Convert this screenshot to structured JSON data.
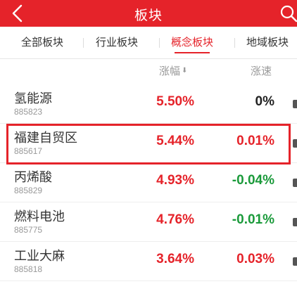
{
  "header": {
    "title": "板块",
    "back_icon": "chevron-left-icon",
    "search_icon": "search-icon",
    "background": "#e5232a"
  },
  "tabs": [
    {
      "label": "全部板块",
      "active": false
    },
    {
      "label": "行业板块",
      "active": false
    },
    {
      "label": "概念板块",
      "active": true
    },
    {
      "label": "地域板块",
      "active": false
    }
  ],
  "columns": {
    "change": "涨幅",
    "change_sort_icon": "arrow-down-icon",
    "speed": "涨速"
  },
  "rows": [
    {
      "name": "氢能源",
      "code": "885823",
      "change": "5.50%",
      "speed": "0%",
      "speed_color": "#222222",
      "highlighted": false
    },
    {
      "name": "福建自贸区",
      "code": "885617",
      "change": "5.44%",
      "speed": "0.01%",
      "speed_color": "#e5232a",
      "highlighted": true
    },
    {
      "name": "丙烯酸",
      "code": "885829",
      "change": "4.93%",
      "speed": "-0.04%",
      "speed_color": "#1a9a3a",
      "highlighted": false
    },
    {
      "name": "燃料电池",
      "code": "885775",
      "change": "4.76%",
      "speed": "-0.01%",
      "speed_color": "#1a9a3a",
      "highlighted": false
    },
    {
      "name": "工业大麻",
      "code": "885818",
      "change": "3.64%",
      "speed": "0.03%",
      "speed_color": "#e5232a",
      "highlighted": false
    }
  ],
  "colors": {
    "accent": "#e5232a",
    "up": "#e5232a",
    "down": "#1a9a3a",
    "flat": "#222222"
  }
}
